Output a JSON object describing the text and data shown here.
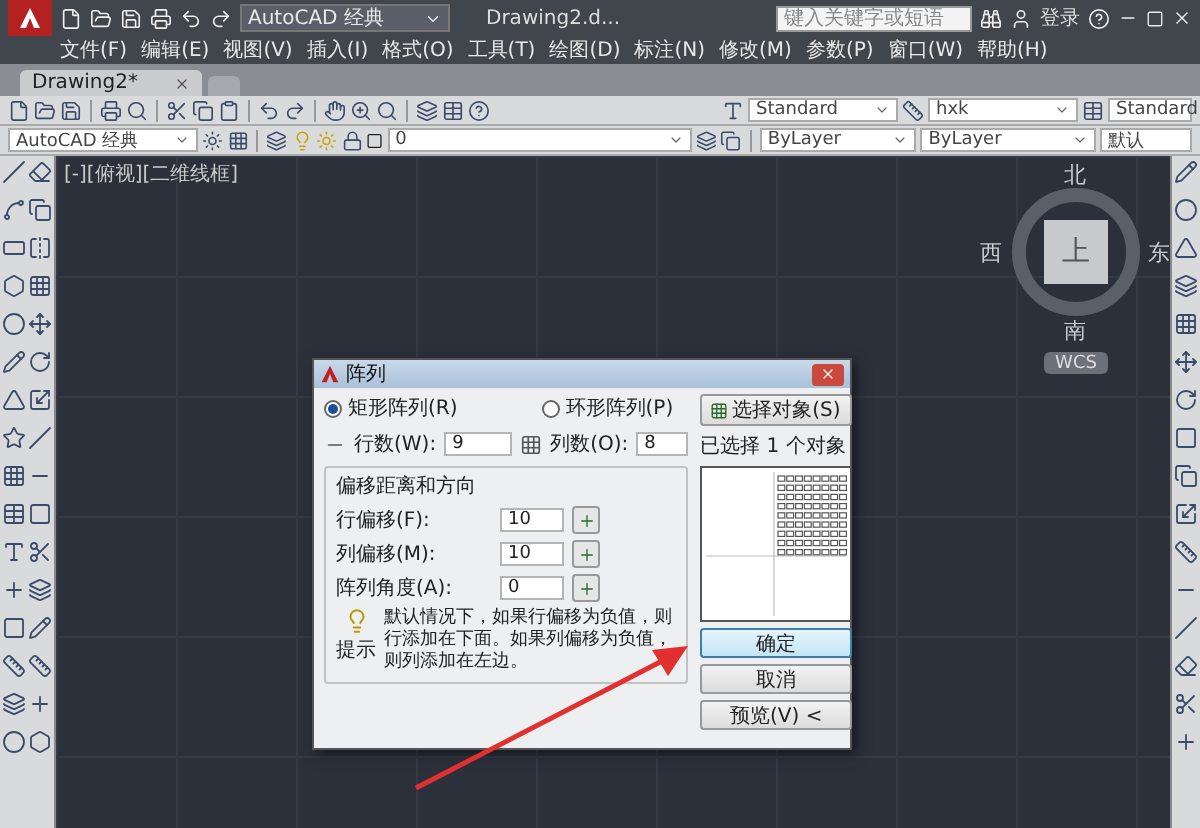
{
  "title_bar": {
    "workspace": "AutoCAD 经典",
    "title": "Drawing2.d...",
    "search_placeholder": "键入关键字或短语",
    "login": "登录"
  },
  "menu": [
    "文件(F)",
    "编辑(E)",
    "视图(V)",
    "插入(I)",
    "格式(O)",
    "工具(T)",
    "绘图(D)",
    "标注(N)",
    "修改(M)",
    "参数(P)",
    "窗口(W)",
    "帮助(H)"
  ],
  "doc_tabs": [
    {
      "label": "Drawing2*",
      "selected": true
    }
  ],
  "toolbar": {
    "text_style": "Standard",
    "dim_style": "hxk",
    "table_style": "Standard"
  },
  "properties_bar": {
    "workspace": "AutoCAD 经典",
    "layer": "0",
    "color_setting": "ByLayer",
    "linetype": "ByLayer",
    "lineweight": "默认"
  },
  "viewport_label": "[-][俯视][二维线框]",
  "viewcube": {
    "north": "北",
    "south": "南",
    "east": "东",
    "west": "西",
    "face": "上",
    "ucs": "WCS"
  },
  "dialog": {
    "title": "阵列",
    "types": [
      {
        "label": "矩形阵列(R)",
        "selected": true
      },
      {
        "label": "环形阵列(P)",
        "selected": false
      }
    ],
    "rows": {
      "label": "行数(W):",
      "value": "9"
    },
    "columns": {
      "label": "列数(O):",
      "value": "8"
    },
    "offset_group": "偏移距离和方向",
    "offsets": [
      {
        "label": "行偏移(F):",
        "value": "10"
      },
      {
        "label": "列偏移(M):",
        "value": "10"
      },
      {
        "label": "阵列角度(A):",
        "value": "0"
      }
    ],
    "tip_label": "提示",
    "tip": "默认情况下，如果行偏移为负值，则行添加在下面。如果列偏移为负值，则列添加在左边。",
    "select_button": "选择对象(S)",
    "selected_count": "已选择 1 个对象",
    "buttons": [
      {
        "label": "确定",
        "selected": true
      },
      {
        "label": "取消",
        "selected": false
      },
      {
        "label": "预览(V) <",
        "selected": false
      }
    ]
  }
}
